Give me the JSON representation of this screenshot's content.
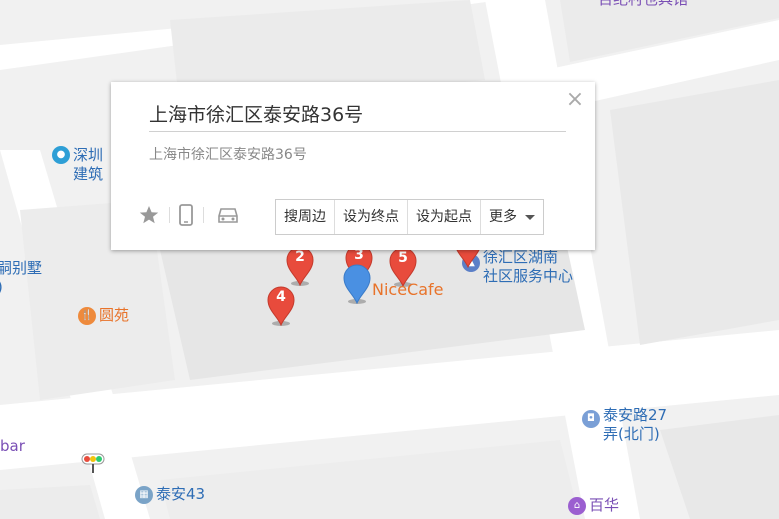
{
  "popup": {
    "title": "上海市徐汇区泰安路36号",
    "address": "上海市徐汇区泰安路36号",
    "close_symbol": "×",
    "actions": {
      "search_nearby": "搜周边",
      "set_destination": "设为终点",
      "set_origin": "设为起点",
      "more": "更多"
    },
    "tools": [
      "star-icon",
      "phone-icon",
      "car-icon"
    ]
  },
  "pois": {
    "shenzhen": "深圳\n建筑",
    "villa": "嗣别墅\n)",
    "yuanyuan": "圆苑",
    "bar": "bar",
    "taian43": "泰安43",
    "xuhui_center": "徐汇区湖南\n社区服务中心",
    "taianlu27": "泰安路27\n弄(北门)",
    "baihua": "百华",
    "top_right": "百纪村也具馆"
  },
  "markers": {
    "m2": "2",
    "m3": "3",
    "m4": "4",
    "m5": "5",
    "nicecafe": "NiceCafe"
  },
  "colors": {
    "marker_red": "#e84b3c",
    "marker_blue": "#4a90e2",
    "poi_blue": "#2e6db5",
    "poi_orange": "#e8732a",
    "poi_purple": "#7a4fb5",
    "food_orange": "#ee8a3c"
  }
}
